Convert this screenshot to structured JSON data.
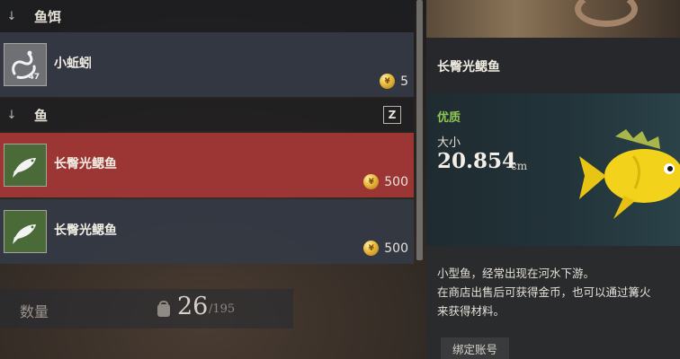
{
  "categories": [
    {
      "arrow": "↓",
      "title": "鱼饵"
    },
    {
      "arrow": "↓",
      "title": "鱼",
      "hotkey": "Z"
    }
  ],
  "bait_items": [
    {
      "name": "小蚯蚓",
      "quantity": "47",
      "price": "5",
      "icon": "worm-icon"
    }
  ],
  "fish_items": [
    {
      "name": "长臀光鳃鱼",
      "price": "500",
      "icon": "fish-icon",
      "selected": true
    },
    {
      "name": "长臀光鳃鱼",
      "price": "500",
      "icon": "fish-icon",
      "selected": false
    }
  ],
  "coin_symbol": "¥",
  "quantity_bar": {
    "label": "数量",
    "current": "26",
    "max": "/195",
    "icon": "bag-icon"
  },
  "detail": {
    "title": "长臀光鳃鱼",
    "quality": "优质",
    "size_label": "大小",
    "size_value": "20.854",
    "size_unit": "cm",
    "description": [
      "小型鱼，经常出现在河水下游。",
      "在商店出售后可获得金币，也可以通过篝火",
      "来获得材料。"
    ],
    "bind_tag": "绑定账号"
  },
  "colors": {
    "selected_row": "#9b3634",
    "quality_green": "#8ec651",
    "fish_icon_bg": "#4a6a37",
    "coin_gold": "#e9b83a",
    "fish_yellow": "#f2d21a"
  }
}
